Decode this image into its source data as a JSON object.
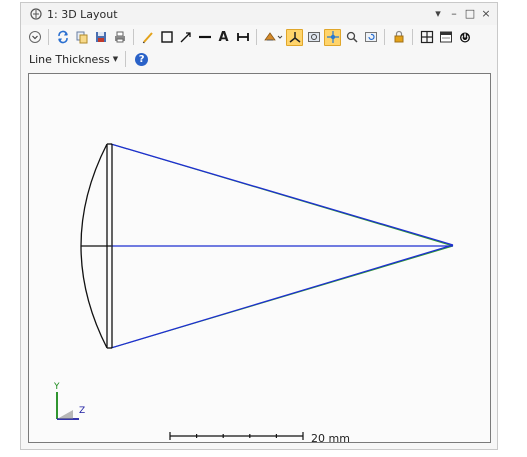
{
  "window": {
    "title": "1: 3D Layout",
    "controls": [
      "▾",
      "–",
      "□",
      "×"
    ]
  },
  "toolbar": {
    "buttons": [
      {
        "name": "expand-icon"
      },
      {
        "name": "refresh-icon"
      },
      {
        "name": "copy-icon"
      },
      {
        "name": "save-icon"
      },
      {
        "name": "print-icon"
      },
      {
        "name": "pencil-icon"
      },
      {
        "name": "rectangle-icon"
      },
      {
        "name": "arrow-icon"
      },
      {
        "name": "line-icon"
      },
      {
        "name": "text-icon"
      },
      {
        "name": "dimension-icon"
      },
      {
        "name": "rotate-icon"
      },
      {
        "name": "axes-icon",
        "active": true
      },
      {
        "name": "zoom-rect-icon"
      },
      {
        "name": "pan-icon",
        "active": true
      },
      {
        "name": "zoom-icon"
      },
      {
        "name": "reset-icon"
      },
      {
        "name": "lock-icon"
      },
      {
        "name": "fit-icon"
      },
      {
        "name": "window-icon"
      },
      {
        "name": "power-icon"
      }
    ],
    "text_label": "A",
    "line_thickness_label": "Line Thickness",
    "help_label": "?"
  },
  "plot": {
    "scale_label": "20 mm",
    "axis_labels": {
      "y": "Y",
      "z": "Z"
    },
    "ray_color": "#1e2fd0",
    "ray_secondary_color": "#2a9a2a",
    "lens_color": "#111111"
  }
}
